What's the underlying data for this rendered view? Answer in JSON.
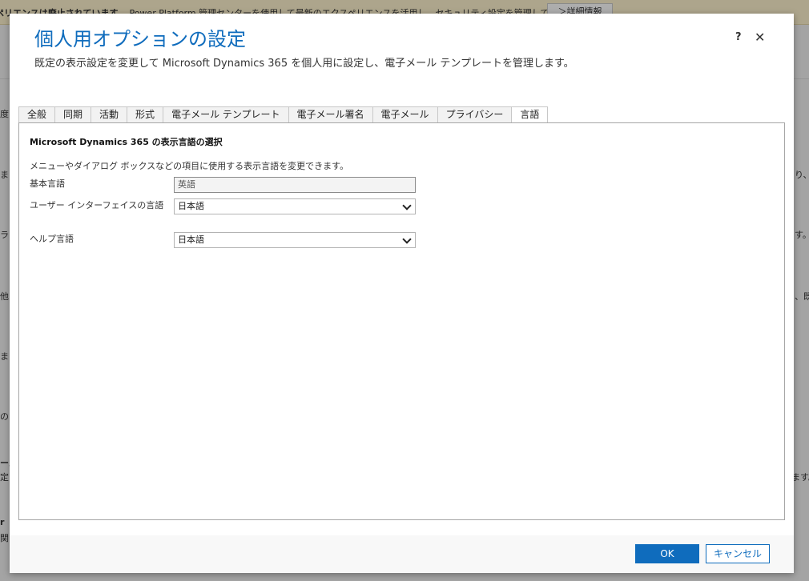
{
  "background": {
    "banner_bold": "ペリエンスは廃止されています",
    "banner_text": "Power Platform 管理センターを使用して最新のエクスペリエンスを活用し、セキュリティ設定を管理してください。",
    "banner_button": "＞詳細情報",
    "left_fragments": [
      "度",
      "ま",
      "ラ",
      "他",
      "ま",
      "の",
      "ール",
      "定",
      "r",
      "関"
    ],
    "right_fragments": [
      "り、",
      "す。",
      "、既",
      "ます。"
    ]
  },
  "dialog": {
    "title": "個人用オプションの設定",
    "subtitle": "既定の表示設定を変更して Microsoft Dynamics 365 を個人用に設定し、電子メール テンプレートを管理します。",
    "help_icon": "question-icon",
    "close_icon": "close-icon",
    "help_label": "?",
    "close_label": "✕"
  },
  "tabs": [
    {
      "label": "全般"
    },
    {
      "label": "同期"
    },
    {
      "label": "活動"
    },
    {
      "label": "形式"
    },
    {
      "label": "電子メール テンプレート"
    },
    {
      "label": "電子メール署名"
    },
    {
      "label": "電子メール"
    },
    {
      "label": "プライバシー"
    },
    {
      "label": "言語",
      "active": true
    }
  ],
  "language": {
    "section_title": "Microsoft Dynamics 365 の表示言語の選択",
    "description": "メニューやダイアログ ボックスなどの項目に使用する表示言語を変更できます。",
    "base_language_label": "基本言語",
    "base_language_value": "英語",
    "ui_language_label": "ユーザー インターフェイスの言語",
    "ui_language_value": "日本語",
    "help_language_label": "ヘルプ言語",
    "help_language_value": "日本語"
  },
  "footer": {
    "ok_label": "OK",
    "cancel_label": "キャンセル"
  },
  "colors": {
    "accent": "#0f6cbd",
    "banner": "#fff4ce"
  }
}
